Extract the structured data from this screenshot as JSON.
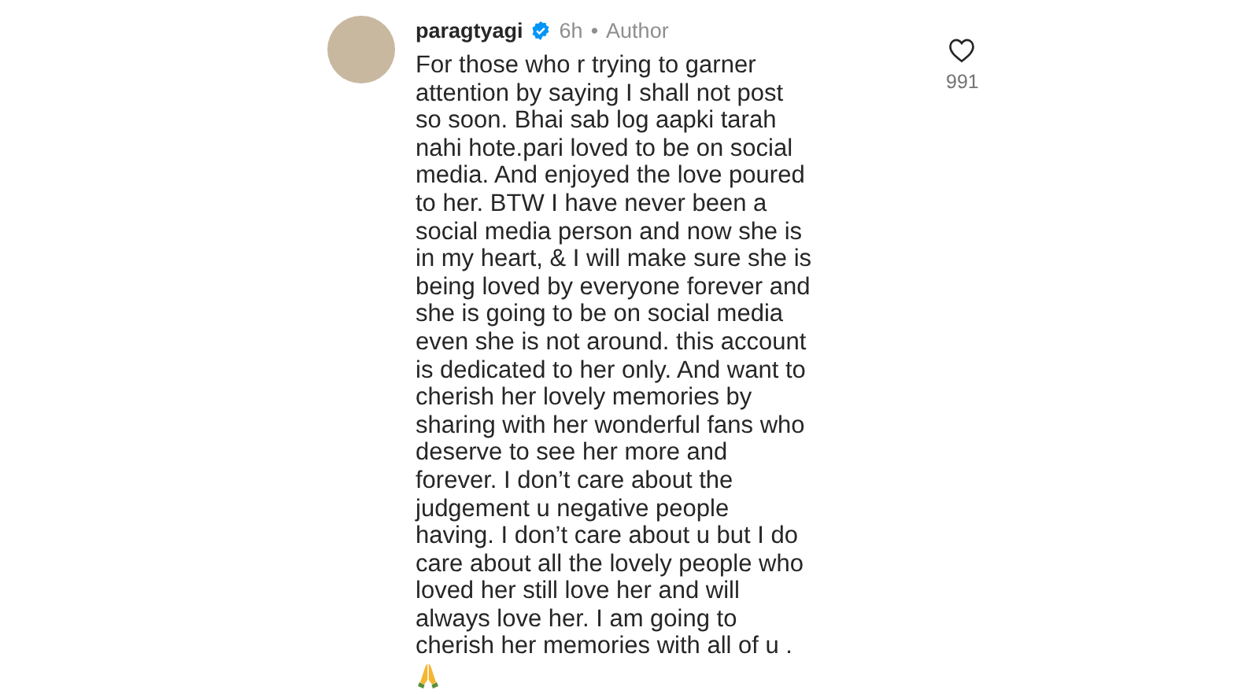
{
  "comment": {
    "username": "paragtyagi",
    "verified": true,
    "time": "6h",
    "separator": "•",
    "role": "Author",
    "text": "For those who r trying to garner\nattention by saying I shall not post\nso soon. Bhai sab log aapki tarah\nnahi hote.pari loved to be on social\nmedia. And enjoyed the love poured\nto her. BTW I have never been a\nsocial media person and now she is\nin my heart, & I will make sure she is\nbeing loved by everyone forever and\nshe is going to be on social media\neven she is not around. this account\nis dedicated to her only. And want to\ncherish her lovely memories by\nsharing with her wonderful fans who\ndeserve to see her more and\nforever. I don’t care about the\njudgement u negative people\nhaving. I don’t care about u but I do\ncare about all the lovely people who\nloved her still love her and will\nalways love her. I am going to\ncherish her memories with all of u .",
    "liked": false,
    "likes": "991"
  }
}
